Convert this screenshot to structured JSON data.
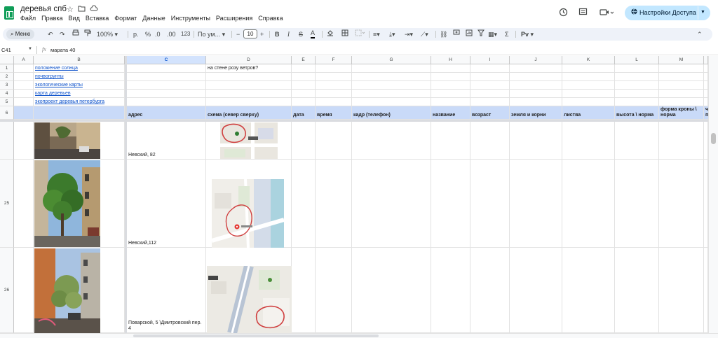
{
  "app": {
    "doc_title": "деревья спб",
    "menu": [
      "Файл",
      "Правка",
      "Вид",
      "Вставка",
      "Формат",
      "Данные",
      "Инструменты",
      "Расширения",
      "Справка"
    ],
    "share_label": "Настройки Доступа"
  },
  "toolbar": {
    "menu_search": "Меню",
    "zoom": "100%",
    "currency": "р.",
    "percent": "%",
    "dec_decrease": ".0",
    "dec_increase": ".00",
    "number_format": "123",
    "font": "По ум...",
    "font_size": "10"
  },
  "formula_bar": {
    "cell_ref": "C41",
    "fx": "fx",
    "value": "марата 40"
  },
  "columns": [
    "A",
    "B",
    "C",
    "D",
    "E",
    "F",
    "G",
    "H",
    "I",
    "J",
    "K",
    "L",
    "M"
  ],
  "rows": {
    "r1": {
      "num": "1",
      "b": "положение солнца",
      "d": "на стене розу ветров?"
    },
    "r2": {
      "num": "2",
      "b": "почвогрунты"
    },
    "r3": {
      "num": "3",
      "b": "экологические карты"
    },
    "r4": {
      "num": "4",
      "b": "карта деревьев"
    },
    "r5": {
      "num": "5",
      "b": "экопроект деревья петербурга"
    },
    "r6": {
      "num": "6",
      "c": "адрес",
      "d": "схема (север сверху)",
      "e": "дата",
      "f": "время",
      "g": "кадр (телефон)",
      "h": "название",
      "i": "возраст",
      "j": "земля и корни",
      "k": "листва",
      "l": "высота \\ норма",
      "m": "форма кроны \\ норма",
      "n": "ч п"
    },
    "r24": {
      "num": "",
      "c": "Невский, 82"
    },
    "r25": {
      "num": "25",
      "c": "Невский,112"
    },
    "r26": {
      "num": "26",
      "c": "Поварской, 5 \\Дмитровский пер. 4"
    }
  },
  "colors": {
    "header_fill": "#c9daf8",
    "selected_col": "#d3e3fd",
    "link": "#1155cc",
    "share_button": "#c2e7ff"
  }
}
